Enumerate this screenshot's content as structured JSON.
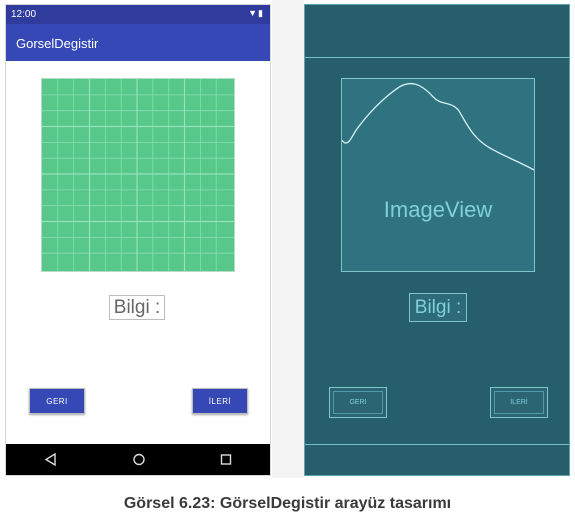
{
  "phone": {
    "status_time": "12:00",
    "app_title": "GorselDegistir",
    "info_label": "Bilgi :",
    "back_button": "GERI",
    "next_button": "İLERİ",
    "nav": {
      "back_icon": "triangle-back-icon",
      "home_icon": "circle-home-icon",
      "recent_icon": "square-recent-icon"
    }
  },
  "blueprint": {
    "image_label": "ImageView",
    "info_label": "Bilgi :",
    "back_button": "GERI",
    "next_button": "İLERİ"
  },
  "caption": "Görsel 6.23: GörselDegistir arayüz tasarımı",
  "colors": {
    "appbar": "#3548b5",
    "statusbar": "#2f3c9e",
    "image_green": "#57c78a",
    "blueprint_bg": "#275e6c"
  }
}
